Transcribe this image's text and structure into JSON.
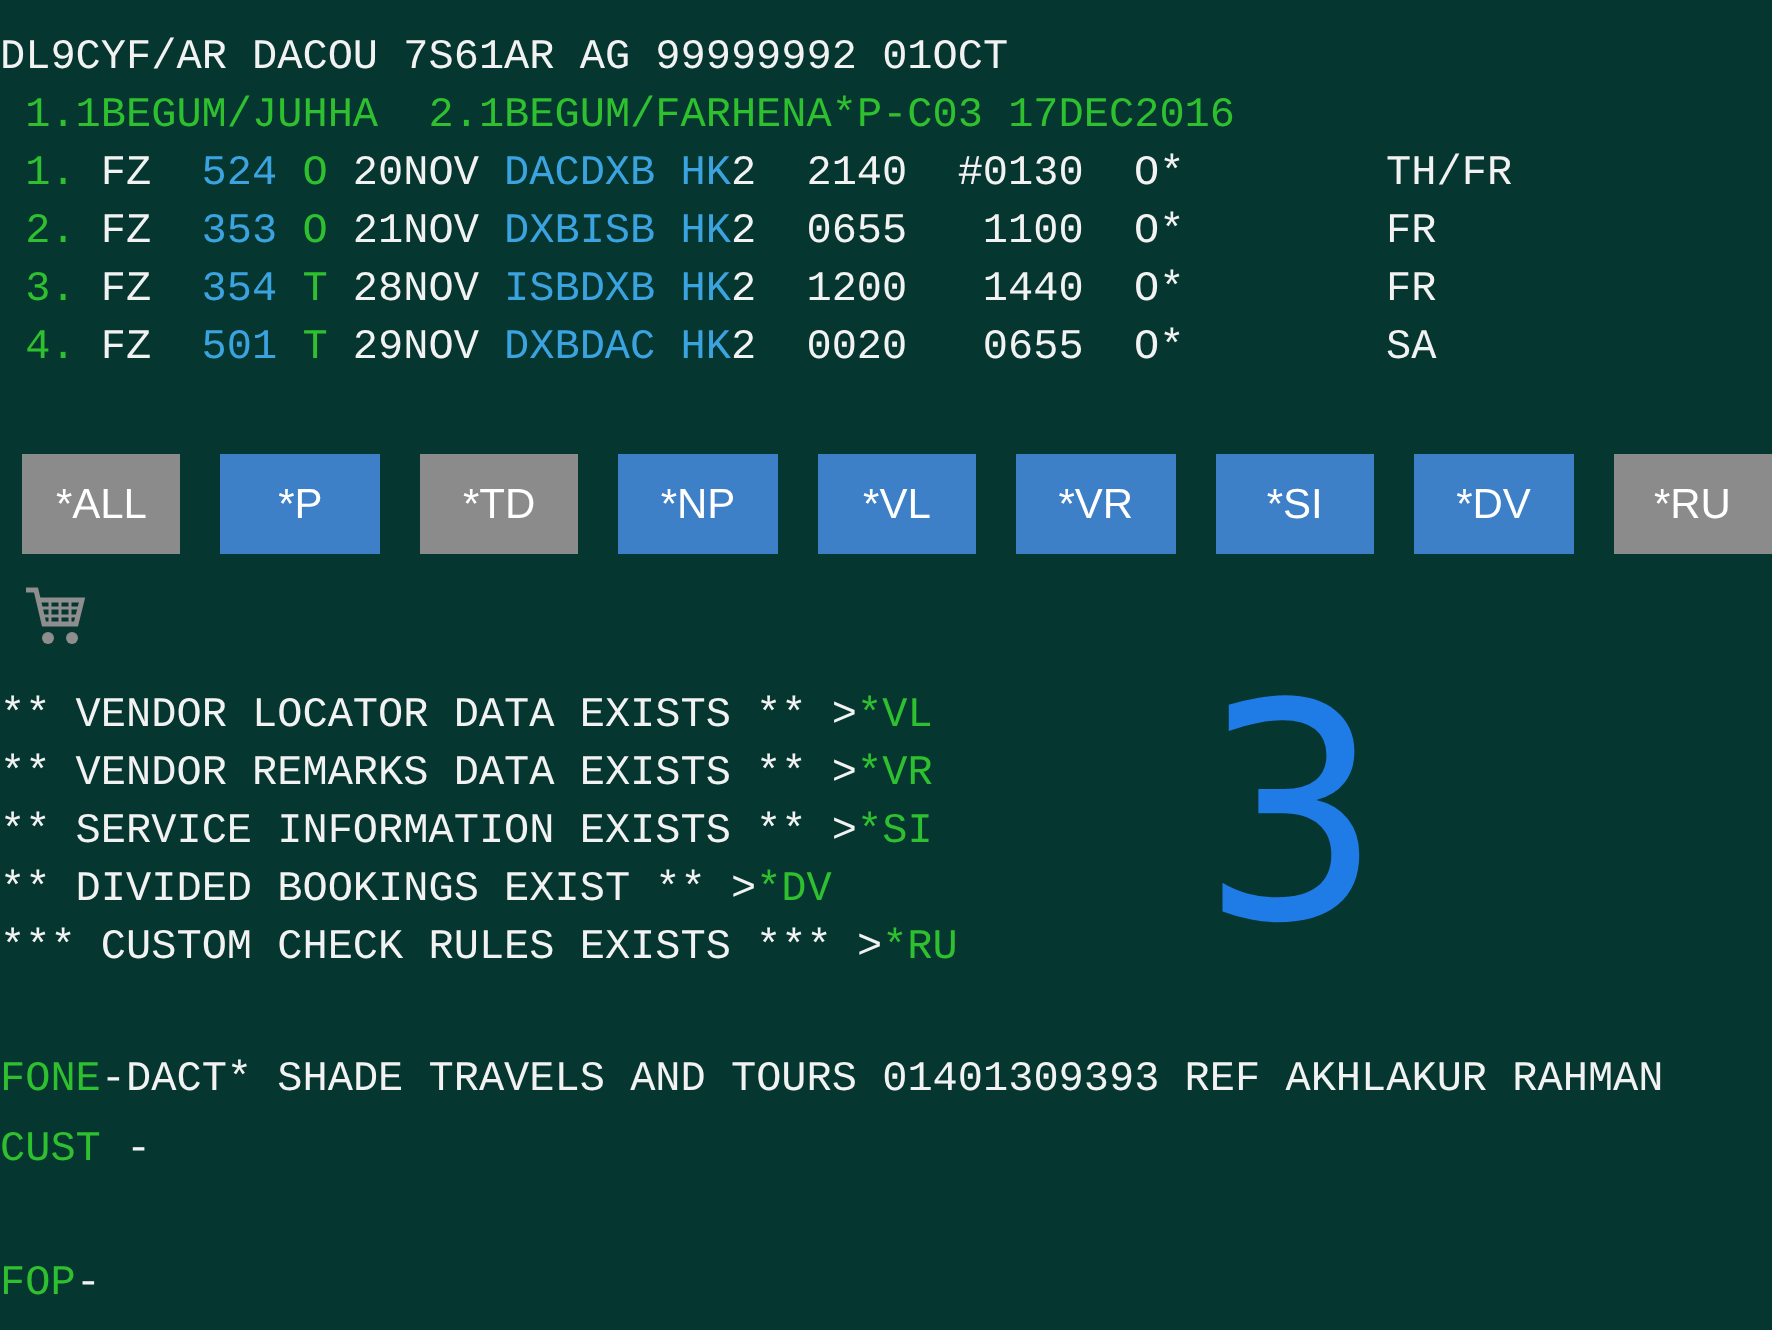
{
  "header": {
    "record_line": "DL9CYF/AR DACOU 7S61AR AG 99999992 01OCT",
    "passengers": [
      "1.1BEGUM/JUHHA",
      "2.1BEGUM/FARHENA*P-C03 17DEC2016"
    ]
  },
  "segments": [
    {
      "number": "1.",
      "airline": "FZ",
      "flight": "524",
      "class": "O",
      "date": "20NOV",
      "route": "DACDXB",
      "status_code": "HK",
      "seats": "2",
      "depart": "2140",
      "arrive": "#0130",
      "flag": "O*",
      "days": "TH/FR"
    },
    {
      "number": "2.",
      "airline": "FZ",
      "flight": "353",
      "class": "O",
      "date": "21NOV",
      "route": "DXBISB",
      "status_code": "HK",
      "seats": "2",
      "depart": "0655",
      "arrive": "1100",
      "flag": "O*",
      "days": "FR"
    },
    {
      "number": "3.",
      "airline": "FZ",
      "flight": "354",
      "class": "T",
      "date": "28NOV",
      "route": "ISBDXB",
      "status_code": "HK",
      "seats": "2",
      "depart": "1200",
      "arrive": "1440",
      "flag": "O*",
      "days": "FR"
    },
    {
      "number": "4.",
      "airline": "FZ",
      "flight": "501",
      "class": "T",
      "date": "29NOV",
      "route": "DXBDAC",
      "status_code": "HK",
      "seats": "2",
      "depart": "0020",
      "arrive": "0655",
      "flag": "O*",
      "days": "SA"
    }
  ],
  "buttons": [
    {
      "label": "*ALL",
      "disabled": true
    },
    {
      "label": "*P",
      "disabled": false
    },
    {
      "label": "*TD",
      "disabled": true
    },
    {
      "label": "*NP",
      "disabled": false
    },
    {
      "label": "*VL",
      "disabled": false
    },
    {
      "label": "*VR",
      "disabled": false
    },
    {
      "label": "*SI",
      "disabled": false
    },
    {
      "label": "*DV",
      "disabled": false
    },
    {
      "label": "*RU",
      "disabled": true
    }
  ],
  "notices": [
    {
      "text": "** VENDOR LOCATOR DATA EXISTS ** >",
      "command": "*VL"
    },
    {
      "text": "** VENDOR REMARKS DATA EXISTS ** >",
      "command": "*VR"
    },
    {
      "text": "** SERVICE INFORMATION EXISTS ** >",
      "command": "*SI"
    },
    {
      "text": "** DIVIDED BOOKINGS EXIST ** >",
      "command": "*DV"
    },
    {
      "text": "*** CUSTOM CHECK RULES EXISTS *** >",
      "command": "*RU"
    }
  ],
  "annotation": {
    "text": "3"
  },
  "remark_lines": [
    {
      "keyword": "FONE",
      "rest": "-DACT* SHADE TRAVELS AND TOURS 01401309393 REF AKHLAKUR RAHMAN"
    },
    {
      "keyword": "CUST",
      "rest": " -"
    },
    {
      "keyword": "FOP",
      "rest": "-"
    }
  ]
}
